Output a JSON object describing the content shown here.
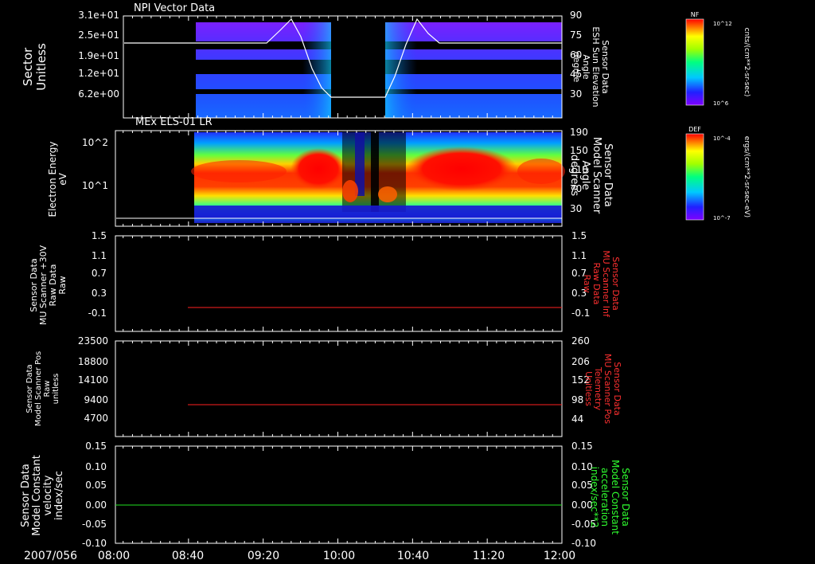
{
  "figure": {
    "date_label": "2007/056",
    "x_ticks": [
      "08:00",
      "08:40",
      "09:20",
      "10:00",
      "10:40",
      "11:20",
      "12:00"
    ]
  },
  "panels": [
    {
      "id": "npi",
      "title": "NPI Vector Data",
      "left_label": [
        "Sector",
        "Unitless"
      ],
      "left_ticks": [
        "3.1e+01",
        "2.5e+01",
        "1.9e+01",
        "1.2e+01",
        "6.2e+00"
      ],
      "right_label": [
        "Sensor Data",
        "ESH Sun Elevation",
        "Angle",
        "degree"
      ],
      "right_ticks": [
        "90",
        "75",
        "60",
        "45",
        "30"
      ],
      "colorbar": {
        "title": "NF",
        "unit": "cnts/(cm**2-sr-sec)",
        "top": "10^12",
        "bottom": "10^6"
      }
    },
    {
      "id": "els",
      "title": "MEx ELS-01 LR",
      "left_label": [
        "Electron Energy",
        "eV"
      ],
      "left_ticks": [
        "10^2",
        "10^1"
      ],
      "right_label": [
        "Sensor Data",
        "Model Scanner",
        "Angle",
        "degrees"
      ],
      "right_ticks": [
        "190",
        "150",
        "110",
        "70",
        "30"
      ],
      "colorbar": {
        "title": "DEF",
        "unit": "ergs/(cm**2-sr-sec-eV)",
        "top": "10^-4",
        "bottom": "10^-7"
      }
    },
    {
      "id": "mu30",
      "left_label": [
        "Sensor Data",
        "MU Scanner +30V",
        "Raw Data",
        "Raw"
      ],
      "left_ticks": [
        "1.5",
        "1.1",
        "0.7",
        "0.3",
        "-0.1"
      ],
      "right_label": [
        "Sensor Data",
        "MU Scanner Inf",
        "Raw Data",
        "Raw"
      ],
      "right_ticks": [
        "1.5",
        "1.1",
        "0.7",
        "0.3",
        "-0.1"
      ]
    },
    {
      "id": "mupos",
      "left_label": [
        "Sensor Data",
        "Model Scanner Pos",
        "Raw",
        "unitless"
      ],
      "left_ticks": [
        "23500",
        "18800",
        "14100",
        "9400",
        "4700"
      ],
      "right_label": [
        "Sensor Data",
        "MU Scanner Pos",
        "Telemetry",
        "Unitless"
      ],
      "right_ticks": [
        "260",
        "206",
        "152",
        "98",
        "44"
      ]
    },
    {
      "id": "vel",
      "left_label": [
        "Sensor Data",
        "Model Constant",
        "velocity",
        "index/sec"
      ],
      "left_ticks": [
        "0.15",
        "0.10",
        "0.05",
        "0.00",
        "-0.05",
        "-0.10"
      ],
      "right_label": [
        "Sensor Data",
        "Model Constant",
        "acceleration",
        "index/sec**2"
      ],
      "right_ticks": [
        "0.15",
        "0.10",
        "0.05",
        "0.00",
        "-0.05",
        "-0.10"
      ]
    }
  ],
  "colors": {
    "axis": "#ffffff",
    "red_trace": "#ff2020",
    "green_trace": "#20e020",
    "red_label": "#ff3030",
    "green_label": "#30ff30"
  },
  "chart_data": [
    {
      "type": "heatmap",
      "title": "NPI Vector Data",
      "xlabel": "",
      "x_range": [
        "08:00",
        "12:00"
      ],
      "ylabel": "Sector Unitless",
      "ylim": [
        0,
        31
      ],
      "data_coverage": [
        "08:40",
        "12:00"
      ],
      "gap": [
        "09:52",
        "10:22"
      ],
      "overlay_line": {
        "name": "ESH Sun Elevation Angle",
        "units": "degree",
        "ylim": [
          15,
          90
        ],
        "x": [
          "08:00",
          "09:10",
          "09:17",
          "09:27",
          "09:40",
          "09:52",
          "10:22",
          "10:30",
          "10:37",
          "10:47",
          "11:00",
          "12:00"
        ],
        "y": [
          72,
          72,
          78,
          86,
          62,
          25,
          25,
          60,
          86,
          78,
          72,
          72
        ]
      }
    },
    {
      "type": "heatmap",
      "title": "MEx ELS-01 LR",
      "ylabel": "Electron Energy eV",
      "yscale": "log",
      "y_ticks": [
        "10^2",
        "10^1"
      ],
      "data_coverage": [
        "08:40",
        "12:00"
      ],
      "overlay_line": {
        "name": "Model Scanner Angle",
        "units": "degrees",
        "ylim": [
          0,
          190
        ],
        "y": [
          15
        ]
      }
    },
    {
      "type": "line",
      "series": [
        {
          "name": "MU Scanner Inf Raw Data",
          "x": [
            "08:40",
            "12:00"
          ],
          "y": [
            -0.1,
            -0.1
          ]
        }
      ],
      "ylim": [
        -0.3,
        1.5
      ],
      "right_ylim": [
        -0.3,
        1.5
      ]
    },
    {
      "type": "line",
      "series": [
        {
          "name": "MU Scanner Pos Telemetry",
          "x": [
            "08:40",
            "12:00"
          ],
          "y": [
            98,
            98
          ]
        }
      ],
      "ylim": [
        0,
        23500
      ],
      "right_ylim": [
        -10,
        260
      ]
    },
    {
      "type": "line",
      "series": [
        {
          "name": "Model Constant acceleration",
          "x": [
            "08:00",
            "12:00"
          ],
          "y": [
            0.0,
            0.0
          ]
        }
      ],
      "ylim": [
        -0.1,
        0.15
      ],
      "right_ylim": [
        -0.1,
        0.15
      ]
    }
  ]
}
